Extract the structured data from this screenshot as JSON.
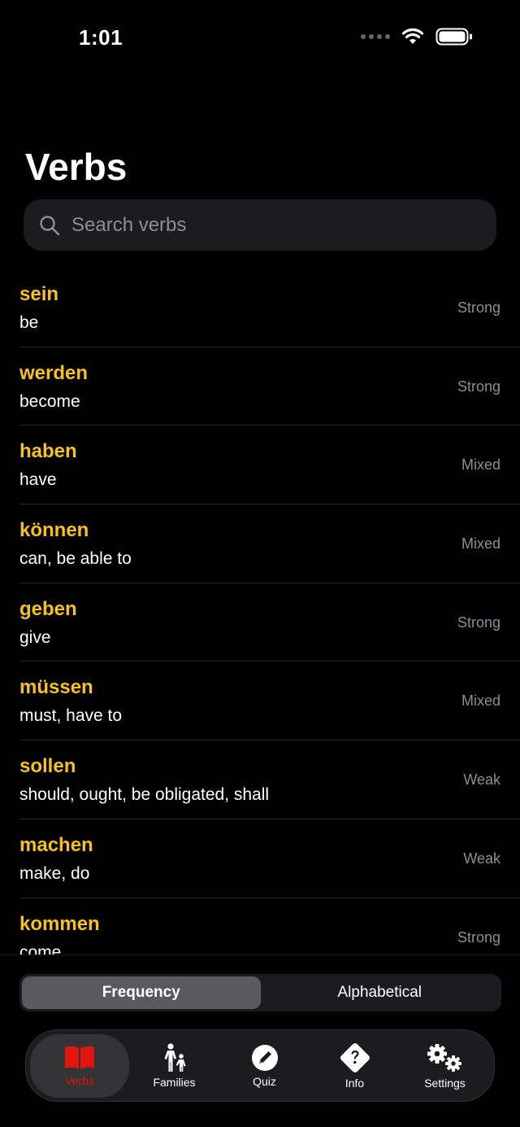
{
  "status": {
    "time": "1:01"
  },
  "page": {
    "title": "Verbs"
  },
  "search": {
    "placeholder": "Search verbs",
    "value": ""
  },
  "verbs": [
    {
      "word": "sein",
      "meaning": "be",
      "type": "Strong"
    },
    {
      "word": "werden",
      "meaning": "become",
      "type": "Strong"
    },
    {
      "word": "haben",
      "meaning": "have",
      "type": "Mixed"
    },
    {
      "word": "können",
      "meaning": "can, be able to",
      "type": "Mixed"
    },
    {
      "word": "geben",
      "meaning": "give",
      "type": "Strong"
    },
    {
      "word": "müssen",
      "meaning": "must, have to",
      "type": "Mixed"
    },
    {
      "word": "sollen",
      "meaning": "should, ought, be obligated, shall",
      "type": "Weak"
    },
    {
      "word": "machen",
      "meaning": "make, do",
      "type": "Weak"
    },
    {
      "word": "kommen",
      "meaning": "come",
      "type": "Strong"
    }
  ],
  "sort": {
    "options": [
      "Frequency",
      "Alphabetical"
    ],
    "selected": "Frequency"
  },
  "tabs": [
    {
      "label": "Verbs",
      "icon": "book-icon",
      "active": true
    },
    {
      "label": "Families",
      "icon": "family-icon",
      "active": false
    },
    {
      "label": "Quiz",
      "icon": "pencil-circle-icon",
      "active": false
    },
    {
      "label": "Info",
      "icon": "question-diamond-icon",
      "active": false
    },
    {
      "label": "Settings",
      "icon": "gears-icon",
      "active": false
    }
  ],
  "colors": {
    "accent": "#f6c21b",
    "active_tab": "#e0150e",
    "background": "#000000"
  }
}
